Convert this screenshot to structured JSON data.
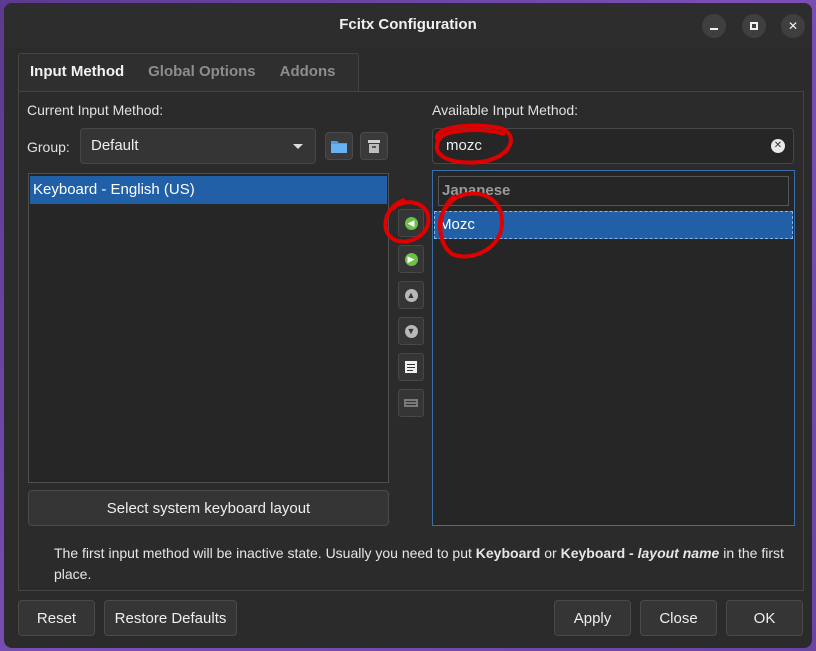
{
  "window": {
    "title": "Fcitx Configuration"
  },
  "tabs": [
    {
      "label": "Input Method",
      "active": true
    },
    {
      "label": "Global Options",
      "active": false
    },
    {
      "label": "Addons",
      "active": false
    }
  ],
  "left": {
    "current_label": "Current Input Method:",
    "group_label": "Group:",
    "group_value": "Default",
    "items": [
      "Keyboard - English (US)"
    ],
    "layout_button": "Select system keyboard layout"
  },
  "right": {
    "available_label": "Available Input Method:",
    "search_value": "mozc",
    "category": "Japanese",
    "items": [
      "Mozc"
    ]
  },
  "info": {
    "prefix": "The first input method will be inactive state. Usually you need to put ",
    "bold1": "Keyboard",
    "mid": " or ",
    "bold2": "Keyboard - ",
    "italic": "layout name",
    "suffix": " in the first place."
  },
  "footer": {
    "reset": "Reset",
    "restore": "Restore Defaults",
    "apply": "Apply",
    "close": "Close",
    "ok": "OK"
  },
  "colors": {
    "selection": "#2160a6",
    "annotation": "#e00000",
    "arrow_green": "#6cc04a"
  }
}
